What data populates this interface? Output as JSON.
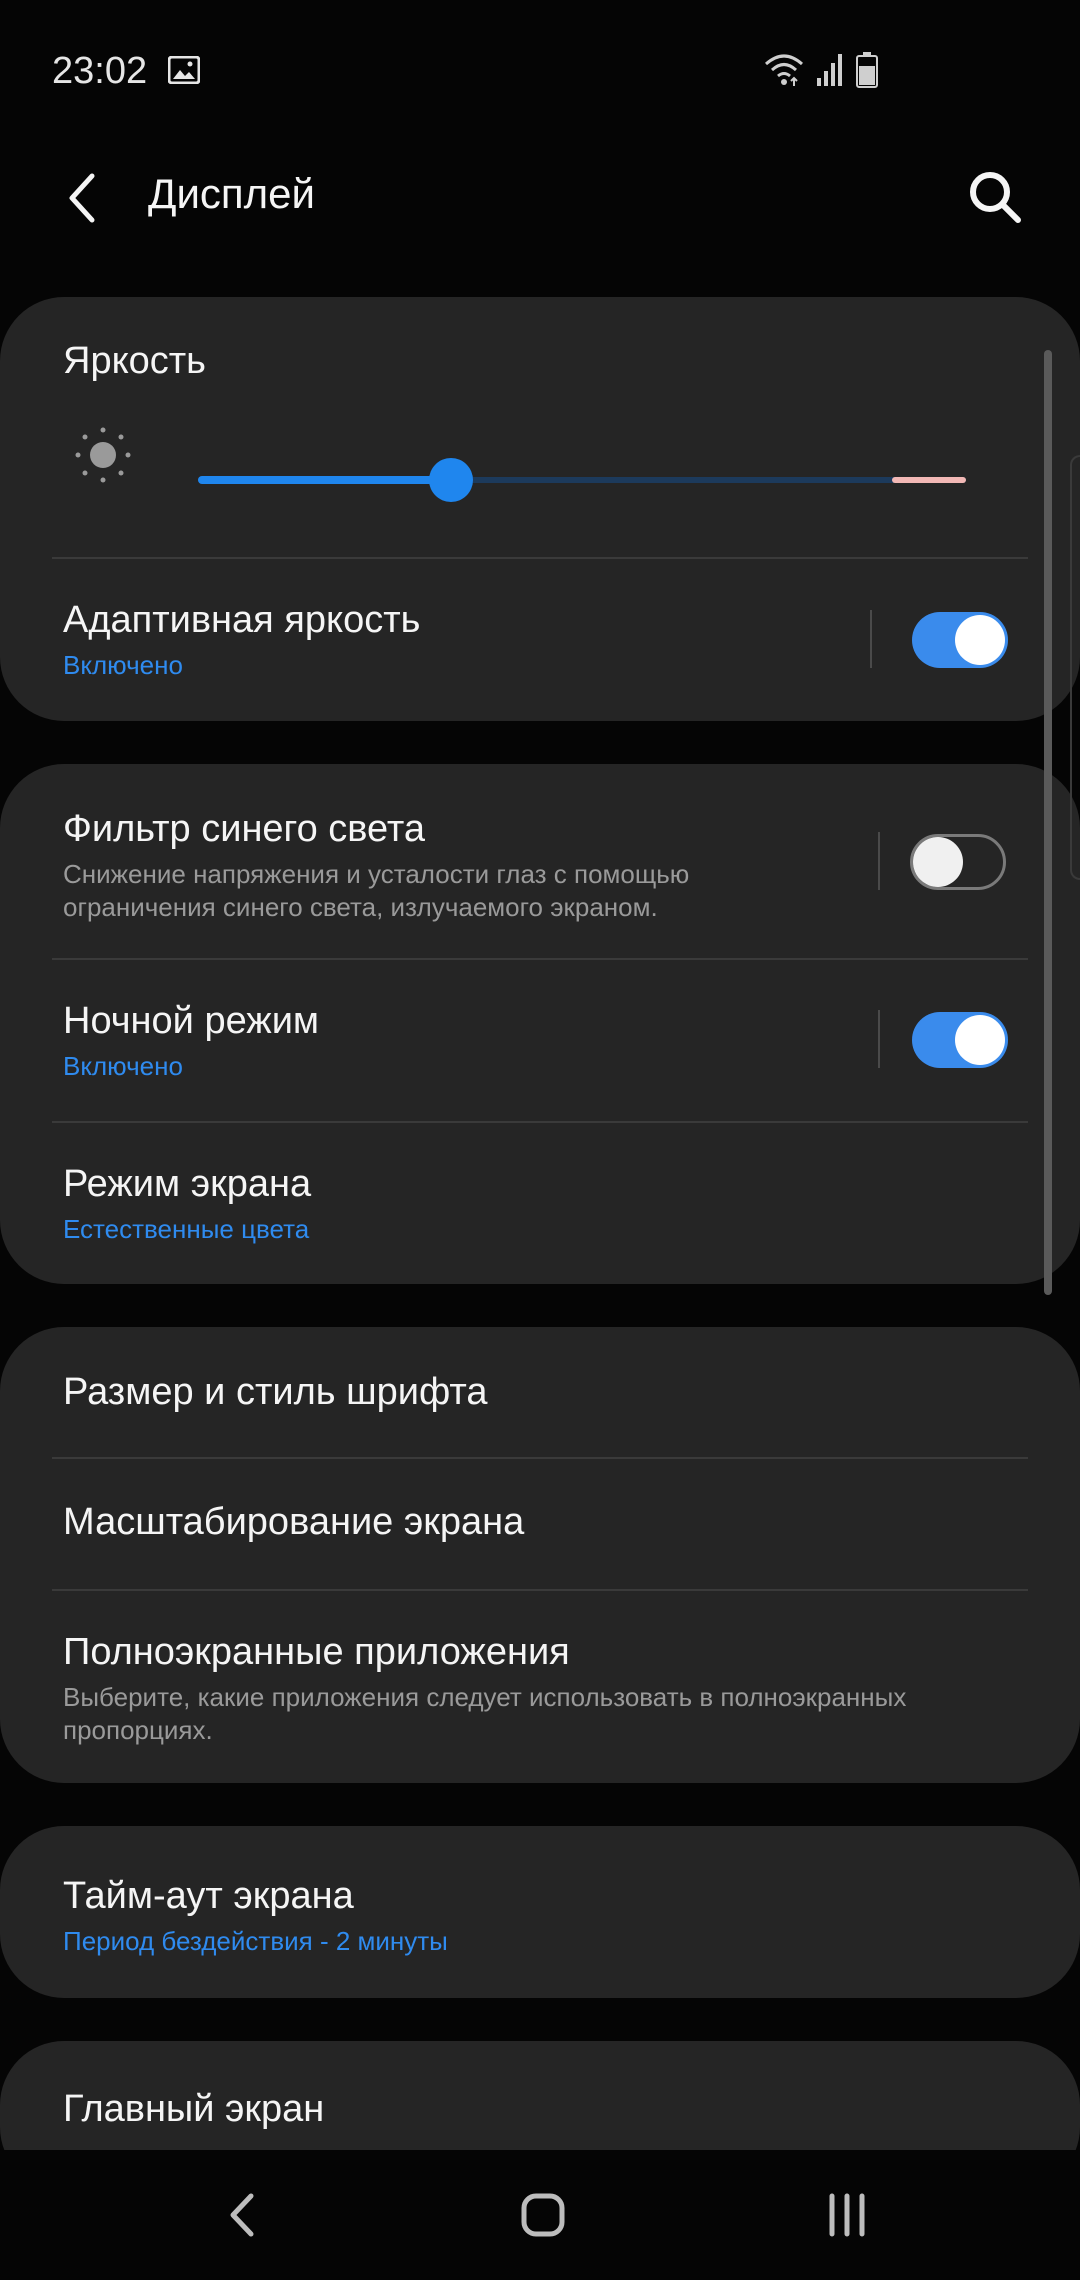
{
  "status_bar": {
    "time": "23:02",
    "icons": [
      "gallery-icon",
      "wifi-icon",
      "signal-icon",
      "battery-icon"
    ]
  },
  "header": {
    "title": "Дисплей",
    "back_icon": "chevron-left-icon",
    "search_icon": "search-icon"
  },
  "brightness": {
    "title": "Яркость",
    "level": 0.33
  },
  "adaptive_brightness": {
    "title": "Адаптивная яркость",
    "status": "Включено",
    "enabled": true
  },
  "blue_light_filter": {
    "title": "Фильтр синего света",
    "description": "Снижение напряжения и усталости глаз с помощью ограничения синего света, излучаемого экраном.",
    "enabled": false
  },
  "night_mode": {
    "title": "Ночной режим",
    "status": "Включено",
    "enabled": true
  },
  "screen_mode": {
    "title": "Режим экрана",
    "value": "Естественные цвета"
  },
  "font_size_style": {
    "title": "Размер и стиль шрифта"
  },
  "screen_zoom": {
    "title": "Масштабирование экрана"
  },
  "fullscreen_apps": {
    "title": "Полноэкранные приложения",
    "description": "Выберите, какие приложения следует использовать в полноэкранных пропорциях."
  },
  "screen_timeout": {
    "title": "Тайм-аут экрана",
    "value": "Период бездействия - 2 минуты"
  },
  "home_screen": {
    "title": "Главный экран"
  },
  "nav_bar": {
    "icons": [
      "back-icon",
      "home-icon",
      "recents-icon"
    ]
  },
  "colors": {
    "accent": "#2f8bef",
    "toggle_on": "#3a8bec",
    "card": "#252525",
    "background": "#050505"
  }
}
